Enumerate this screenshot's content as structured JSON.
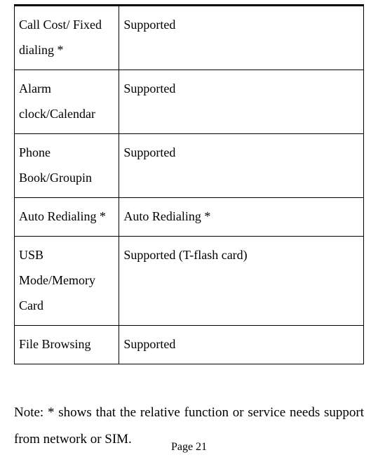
{
  "table": {
    "rows": [
      {
        "feature": "Call Cost/ Fixed dialing *",
        "value": "Supported"
      },
      {
        "feature": "Alarm clock/Calendar",
        "value": "Supported"
      },
      {
        "feature": "Phone Book/Groupin",
        "value": "Supported"
      },
      {
        "feature": "Auto Redialing *",
        "value": "Auto Redialing *"
      },
      {
        "feature": "USB Mode/Memory Card",
        "value": "Supported (T-flash card)"
      },
      {
        "feature": "File Browsing",
        "value": "Supported"
      }
    ]
  },
  "note": "Note: * shows that the relative function or service needs support from network or SIM.",
  "page_number": "Page 21"
}
